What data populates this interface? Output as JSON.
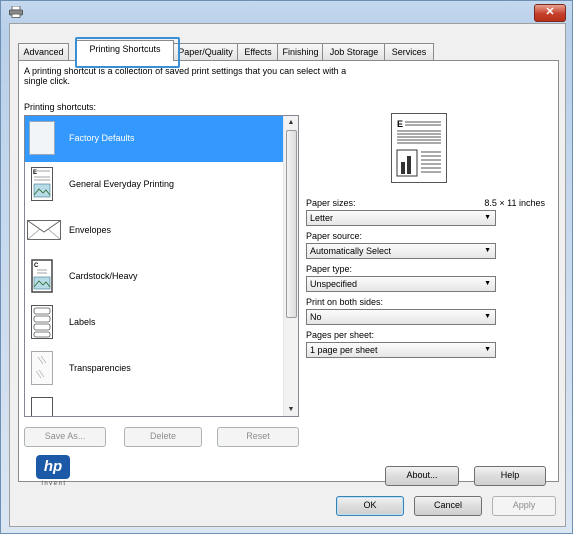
{
  "window": {
    "icon": "printer-icon",
    "close_label": "✕"
  },
  "tabs": [
    {
      "label": "Advanced"
    },
    {
      "label": "Printing Shortcuts"
    },
    {
      "label": "Paper/Quality"
    },
    {
      "label": "Effects"
    },
    {
      "label": "Finishing"
    },
    {
      "label": "Job Storage"
    },
    {
      "label": "Services"
    }
  ],
  "panel": {
    "description": "A printing shortcut is a collection of saved print settings that you can select with a single click.",
    "list_label": "Printing shortcuts:",
    "shortcuts": [
      {
        "label": "Factory Defaults",
        "icon": "blank-page-icon",
        "selected": true
      },
      {
        "label": "General Everyday Printing",
        "icon": "document-landscape-icon",
        "selected": false
      },
      {
        "label": "Envelopes",
        "icon": "envelope-icon",
        "selected": false
      },
      {
        "label": "Cardstock/Heavy",
        "icon": "cardstock-icon",
        "selected": false
      },
      {
        "label": "Labels",
        "icon": "labels-icon",
        "selected": false
      },
      {
        "label": "Transparencies",
        "icon": "transparency-icon",
        "selected": false
      }
    ],
    "buttons": {
      "save_as": "Save As...",
      "delete": "Delete",
      "reset": "Reset"
    },
    "fields": {
      "paper_sizes_label": "Paper sizes:",
      "paper_sizes_dim": "8.5 × 11 inches",
      "paper_sizes_value": "Letter",
      "paper_source_label": "Paper source:",
      "paper_source_value": "Automatically Select",
      "paper_type_label": "Paper type:",
      "paper_type_value": "Unspecified",
      "duplex_label": "Print on both sides:",
      "duplex_value": "No",
      "pages_label": "Pages per sheet:",
      "pages_value": "1 page per sheet"
    },
    "about_label": "About...",
    "help_label": "Help",
    "logo_text": "hp",
    "logo_tagline": "invent"
  },
  "dialog_buttons": {
    "ok": "OK",
    "cancel": "Cancel",
    "apply": "Apply"
  },
  "colors": {
    "selection": "#3399ff",
    "tab_highlight": "#3a8fd6",
    "hp_blue": "#1c5aa8"
  }
}
